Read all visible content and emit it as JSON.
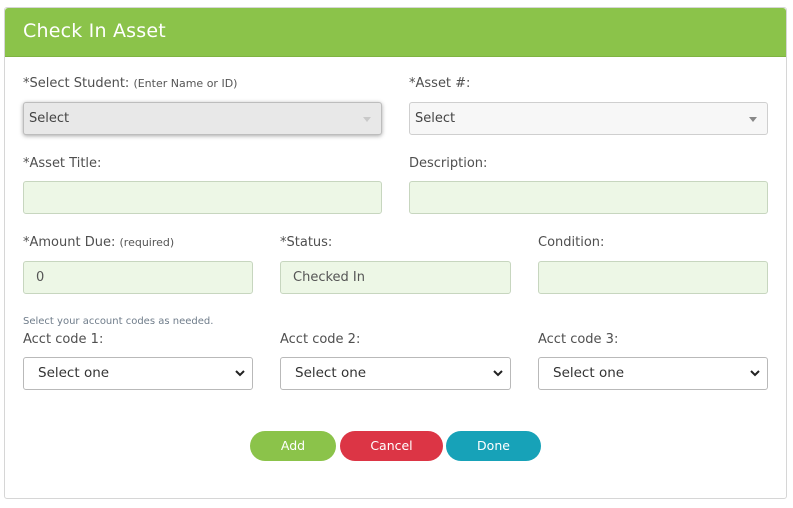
{
  "header": {
    "title": "Check In Asset"
  },
  "form": {
    "student": {
      "label": "*Select Student:",
      "hint": "(Enter Name or ID)",
      "value": "Select"
    },
    "asset_number": {
      "label": "*Asset #:",
      "value": "Select"
    },
    "asset_title": {
      "label": "*Asset Title:",
      "value": ""
    },
    "description": {
      "label": "Description:",
      "value": ""
    },
    "amount_due": {
      "label": "*Amount Due:",
      "hint": "(required)",
      "value": "0"
    },
    "status": {
      "label": "*Status:",
      "value": "Checked In"
    },
    "condition": {
      "label": "Condition:",
      "value": ""
    },
    "acct_hint": "Select your account codes as needed.",
    "acct_codes": [
      {
        "label": "Acct code 1:",
        "value": "Select one"
      },
      {
        "label": "Acct code 2:",
        "value": "Select one"
      },
      {
        "label": "Acct code 3:",
        "value": "Select one"
      }
    ]
  },
  "buttons": {
    "add": "Add",
    "cancel": "Cancel",
    "done": "Done"
  },
  "colors": {
    "header": "#8bc34a",
    "add": "#8bc34a",
    "cancel": "#dc3545",
    "done": "#17a2b8",
    "field_bg": "#edf7e6"
  },
  "icons": {
    "select_caret": "caret-down-icon",
    "native_select": "chevron-down-icon"
  }
}
